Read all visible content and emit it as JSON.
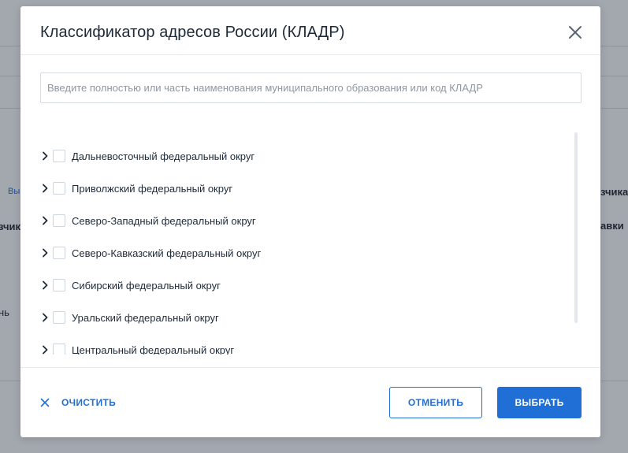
{
  "background": {
    "fragments": [
      "Вы",
      "зчик",
      "нь",
      "зчика",
      "авки"
    ]
  },
  "modal": {
    "title": "Классификатор адресов России (КЛАДР)",
    "close_icon": "close-icon",
    "search": {
      "placeholder": "Введите полностью или часть наименования муниципального образования или код КЛАДР",
      "value": ""
    },
    "items": [
      {
        "label": "Дальневосточный федеральный округ",
        "checked": false,
        "expanded": false
      },
      {
        "label": "Приволжский федеральный округ",
        "checked": false,
        "expanded": false
      },
      {
        "label": "Северо-Западный федеральный округ",
        "checked": false,
        "expanded": false
      },
      {
        "label": "Северо-Кавказский федеральный округ",
        "checked": false,
        "expanded": false
      },
      {
        "label": "Сибирский федеральный округ",
        "checked": false,
        "expanded": false
      },
      {
        "label": "Уральский федеральный округ",
        "checked": false,
        "expanded": false
      },
      {
        "label": "Центральный федеральный округ",
        "checked": false,
        "expanded": false
      }
    ],
    "footer": {
      "clear_label": "ОЧИСТИТЬ",
      "cancel_label": "ОТМЕНИТЬ",
      "select_label": "ВЫБРАТЬ"
    }
  },
  "colors": {
    "accent": "#1f6fd6",
    "overlay": "#a3a7ae",
    "text": "#1e2a38"
  }
}
